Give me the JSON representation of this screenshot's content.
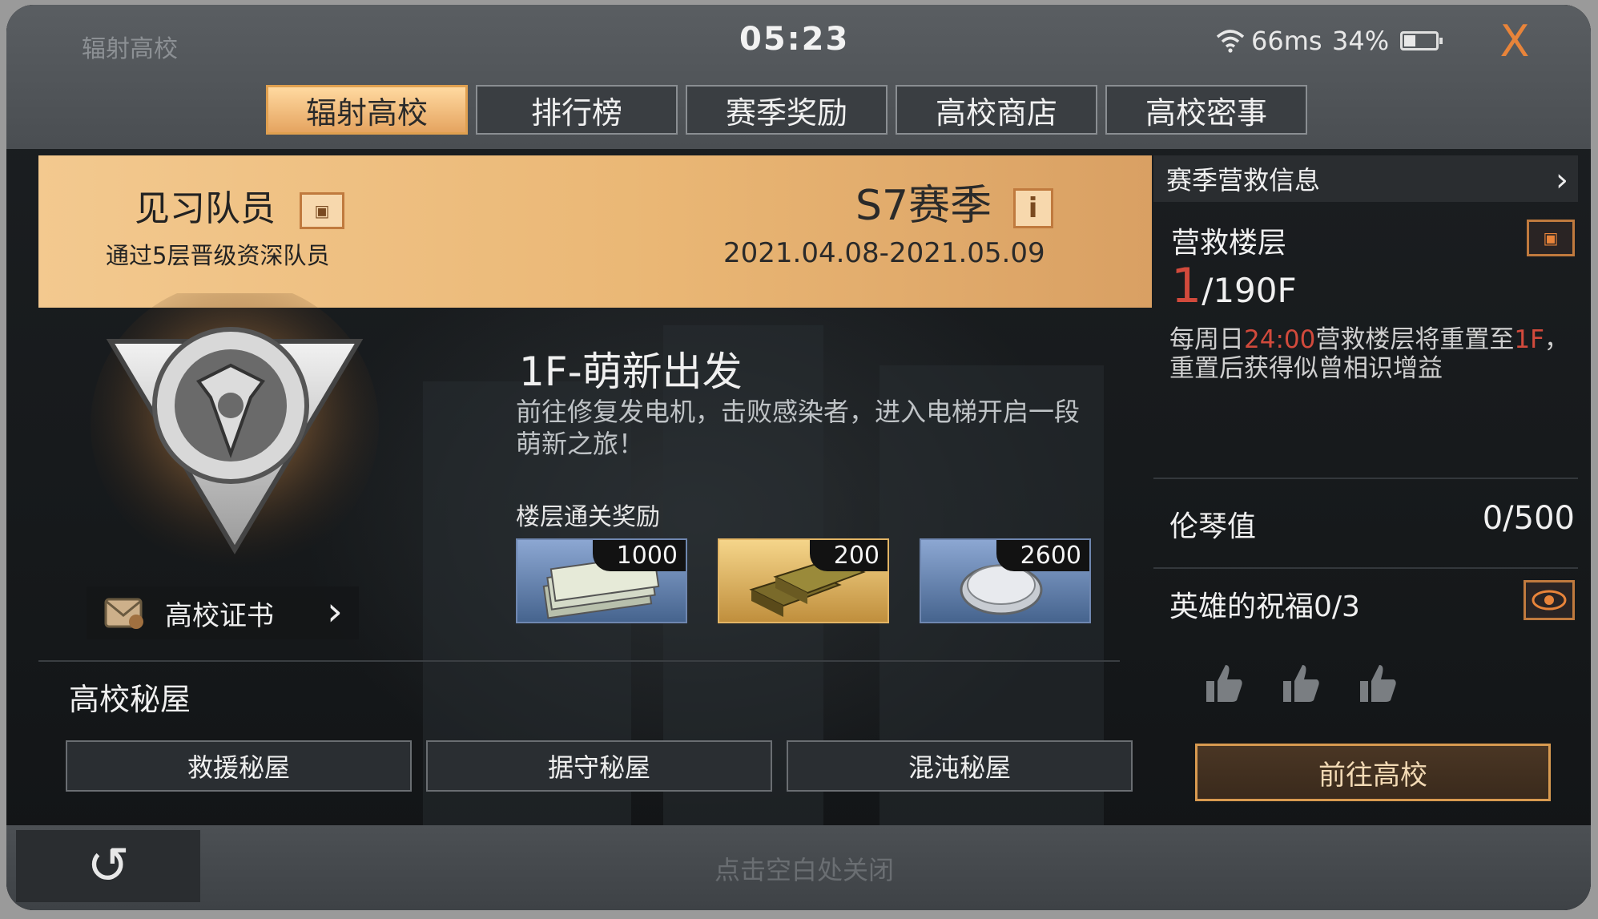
{
  "status": {
    "crumb": "辐射高校",
    "clock": "05:23",
    "ping": "66ms",
    "battery": "34%",
    "battery_level": 0.34
  },
  "close_label": "X",
  "tabs": [
    {
      "label": "辐射高校",
      "active": true
    },
    {
      "label": "排行榜",
      "active": false
    },
    {
      "label": "赛季奖励",
      "active": false
    },
    {
      "label": "高校商店",
      "active": false
    },
    {
      "label": "高校密事",
      "active": false
    }
  ],
  "rank": {
    "title": "见习队员",
    "subtitle": "通过5层晋级资深队员"
  },
  "season": {
    "name": "S7赛季",
    "info_icon": "i",
    "dates": "2021.04.08-2021.05.09"
  },
  "certificate": {
    "label": "高校证书",
    "chevron": "›"
  },
  "stage": {
    "title": "1F-萌新出发",
    "description": "前往修复发电机，击败感染者，进入电梯开启一段萌新之旅！",
    "reward_label": "楼层通关奖励",
    "rewards": [
      {
        "amount": "1000",
        "icon": "cash-icon"
      },
      {
        "amount": "200",
        "icon": "gold-bar-icon"
      },
      {
        "amount": "2600",
        "icon": "silver-coin-icon"
      }
    ]
  },
  "secret_rooms": {
    "title": "高校秘屋",
    "buttons": [
      "救援秘屋",
      "据守秘屋",
      "混沌秘屋"
    ]
  },
  "rescue": {
    "header": "赛季营救信息",
    "floor_title": "营救楼层",
    "current_floor": "1",
    "total_floor": "/190F",
    "note_1": "每周日",
    "note_time": "24:00",
    "note_2": "营救楼层将重置至",
    "note_floor": "1F",
    "note_3": "，重置后获得似曾相识增益",
    "roentgen_label": "伦琴值",
    "roentgen_value": "0/500",
    "blessing_label": "英雄的祝福0/3",
    "go_button": "前往高校"
  },
  "bottom": {
    "back_icon": "↺",
    "hint": "点击空白处关闭"
  },
  "colors": {
    "accent": "#e8843a",
    "banner": "#eab775",
    "red": "#d24a3c"
  }
}
